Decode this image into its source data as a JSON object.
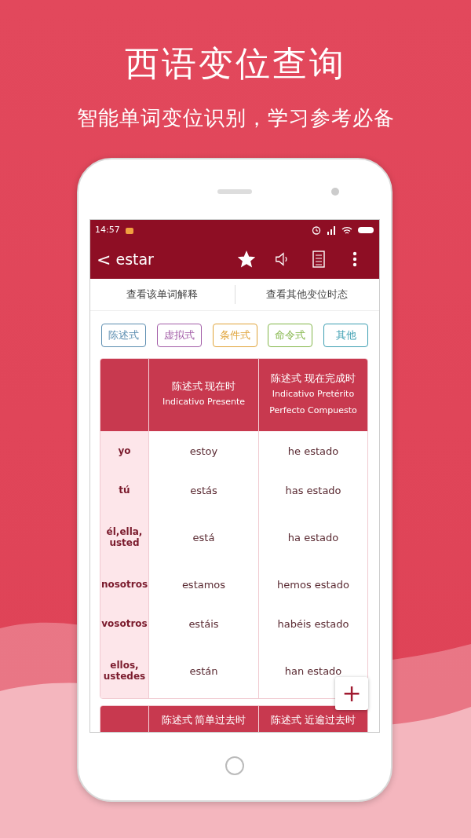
{
  "promo": {
    "title": "西语变位查询",
    "subtitle": "智能单词变位识别，学习参考必备"
  },
  "status_bar": {
    "time": "14:57"
  },
  "app_bar": {
    "back": "<",
    "word": "estar",
    "favorite": true
  },
  "links": [
    "查看该单词解释",
    "查看其他变位时态"
  ],
  "mood_tabs": [
    {
      "label": "陈述式",
      "color": "#5b8db0"
    },
    {
      "label": "虚拟式",
      "color": "#a35ea8"
    },
    {
      "label": "条件式",
      "color": "#e0a43a"
    },
    {
      "label": "命令式",
      "color": "#84b64a"
    },
    {
      "label": "其他",
      "color": "#3e9fb2"
    }
  ],
  "tables": [
    {
      "columns": [
        {
          "cn": "陈述式 现在时",
          "es": "Indicativo Presente"
        },
        {
          "cn": "陈述式 现在完成时",
          "es": "Indicativo Pretérito Perfecto Compuesto"
        }
      ],
      "rows": [
        {
          "person": "yo",
          "forms": [
            "estoy",
            "he estado"
          ]
        },
        {
          "person": "tú",
          "forms": [
            "estás",
            "has estado"
          ]
        },
        {
          "person": "él,ella, usted",
          "forms": [
            "está",
            "ha estado"
          ]
        },
        {
          "person": "nosotros",
          "forms": [
            "estamos",
            "hemos estado"
          ]
        },
        {
          "person": "vosotros",
          "forms": [
            "estáis",
            "habéis estado"
          ]
        },
        {
          "person": "ellos, ustedes",
          "forms": [
            "están",
            "han estado"
          ]
        }
      ]
    },
    {
      "columns": [
        {
          "cn": "陈述式 简单过去时"
        },
        {
          "cn": "陈述式 近逾过去时"
        }
      ]
    }
  ],
  "fab": "+"
}
